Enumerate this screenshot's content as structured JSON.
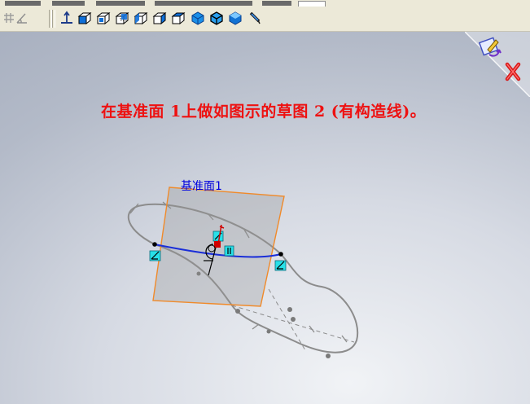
{
  "viewport": {
    "instruction": "在基准面 1上做如图示的草图 2 (有构造线)。",
    "plane_label": "基准面1"
  },
  "toolbar": {
    "icons": [
      "grid-icon",
      "angle-icon",
      "section-view-icon",
      "view-isometric-icon",
      "view-front-icon",
      "view-back-icon",
      "view-left-icon",
      "view-right-icon",
      "view-shaded-icon",
      "view-shaded-edges-icon",
      "view-shaded-solid-icon",
      "pin-tool-icon"
    ]
  },
  "confirmation_corner": {
    "icons": [
      "exit-sketch-icon",
      "cancel-icon"
    ]
  },
  "colors": {
    "background": "#c4cad6",
    "toolbar": "#ece9d8",
    "instruction": "#ee1111",
    "plane_edge": "#f08a2a",
    "sketch_curve": "#1a2ed8",
    "construction_geometry": "#8a8a8a"
  }
}
